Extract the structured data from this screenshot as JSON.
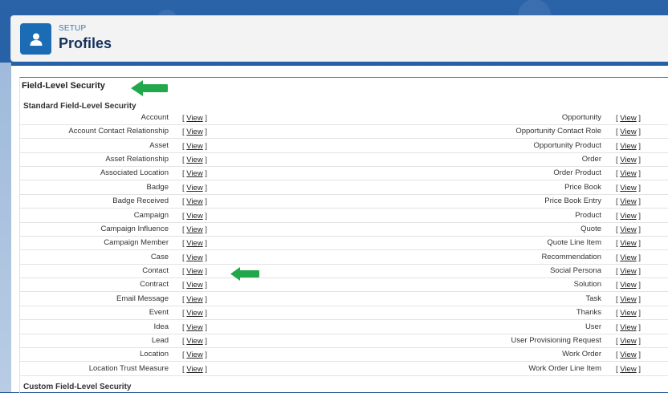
{
  "header": {
    "breadcrumb": "SETUP",
    "title": "Profiles",
    "icon": "user-profile-icon"
  },
  "section": {
    "title": "Field-Level Security",
    "standard_title": "Standard Field-Level Security",
    "custom_title": "Custom Field-Level Security"
  },
  "link": {
    "open": "[",
    "text": "View",
    "close": "]"
  },
  "rows": [
    {
      "left": "Account",
      "right": "Opportunity"
    },
    {
      "left": "Account Contact Relationship",
      "right": "Opportunity Contact Role"
    },
    {
      "left": "Asset",
      "right": "Opportunity Product"
    },
    {
      "left": "Asset Relationship",
      "right": "Order"
    },
    {
      "left": "Associated Location",
      "right": "Order Product"
    },
    {
      "left": "Badge",
      "right": "Price Book"
    },
    {
      "left": "Badge Received",
      "right": "Price Book Entry"
    },
    {
      "left": "Campaign",
      "right": "Product"
    },
    {
      "left": "Campaign Influence",
      "right": "Quote"
    },
    {
      "left": "Campaign Member",
      "right": "Quote Line Item"
    },
    {
      "left": "Case",
      "right": "Recommendation"
    },
    {
      "left": "Contact",
      "right": "Social Persona"
    },
    {
      "left": "Contract",
      "right": "Solution"
    },
    {
      "left": "Email Message",
      "right": "Task"
    },
    {
      "left": "Event",
      "right": "Thanks"
    },
    {
      "left": "Idea",
      "right": "User"
    },
    {
      "left": "Lead",
      "right": "User Provisioning Request"
    },
    {
      "left": "Location",
      "right": "Work Order"
    },
    {
      "left": "Location Trust Measure",
      "right": "Work Order Line Item"
    }
  ],
  "annotations": {
    "arrow_color": "#22a84a",
    "arrows": [
      "section-title-arrow",
      "contact-row-arrow"
    ]
  }
}
